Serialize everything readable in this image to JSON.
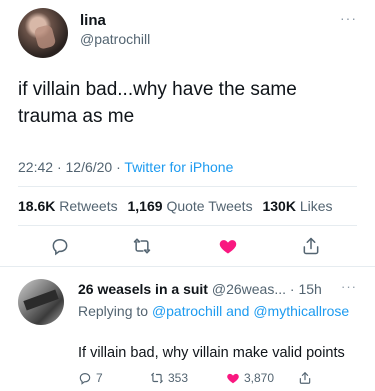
{
  "tweet": {
    "name": "lina",
    "handle": "@patrochill",
    "more": "···",
    "text": "if villain bad...why have the same trauma as me",
    "time": "22:42",
    "date": "12/6/20",
    "source": "Twitter for iPhone",
    "stats": {
      "retweets_count": "18.6K",
      "retweets_label": "Retweets",
      "quotes_count": "1,169",
      "quotes_label": "Quote Tweets",
      "likes_count": "130K",
      "likes_label": "Likes"
    },
    "actions": {
      "reply_icon": "reply-icon",
      "retweet_icon": "retweet-icon",
      "like_icon": "heart-icon",
      "share_icon": "share-icon"
    },
    "colors": {
      "like": "#f91880",
      "link": "#1d9bf0",
      "muted": "#536471"
    }
  },
  "reply": {
    "name": "26 weasels in a suit",
    "handle": "@26weas...",
    "age": "15h",
    "more": "···",
    "replying_prefix": "Replying to",
    "replying_users": "@patrochill and @mythicallrose",
    "text": "If villain bad, why villain make valid points",
    "reply_count": "7",
    "retweet_count": "353",
    "like_count": "3,870"
  }
}
